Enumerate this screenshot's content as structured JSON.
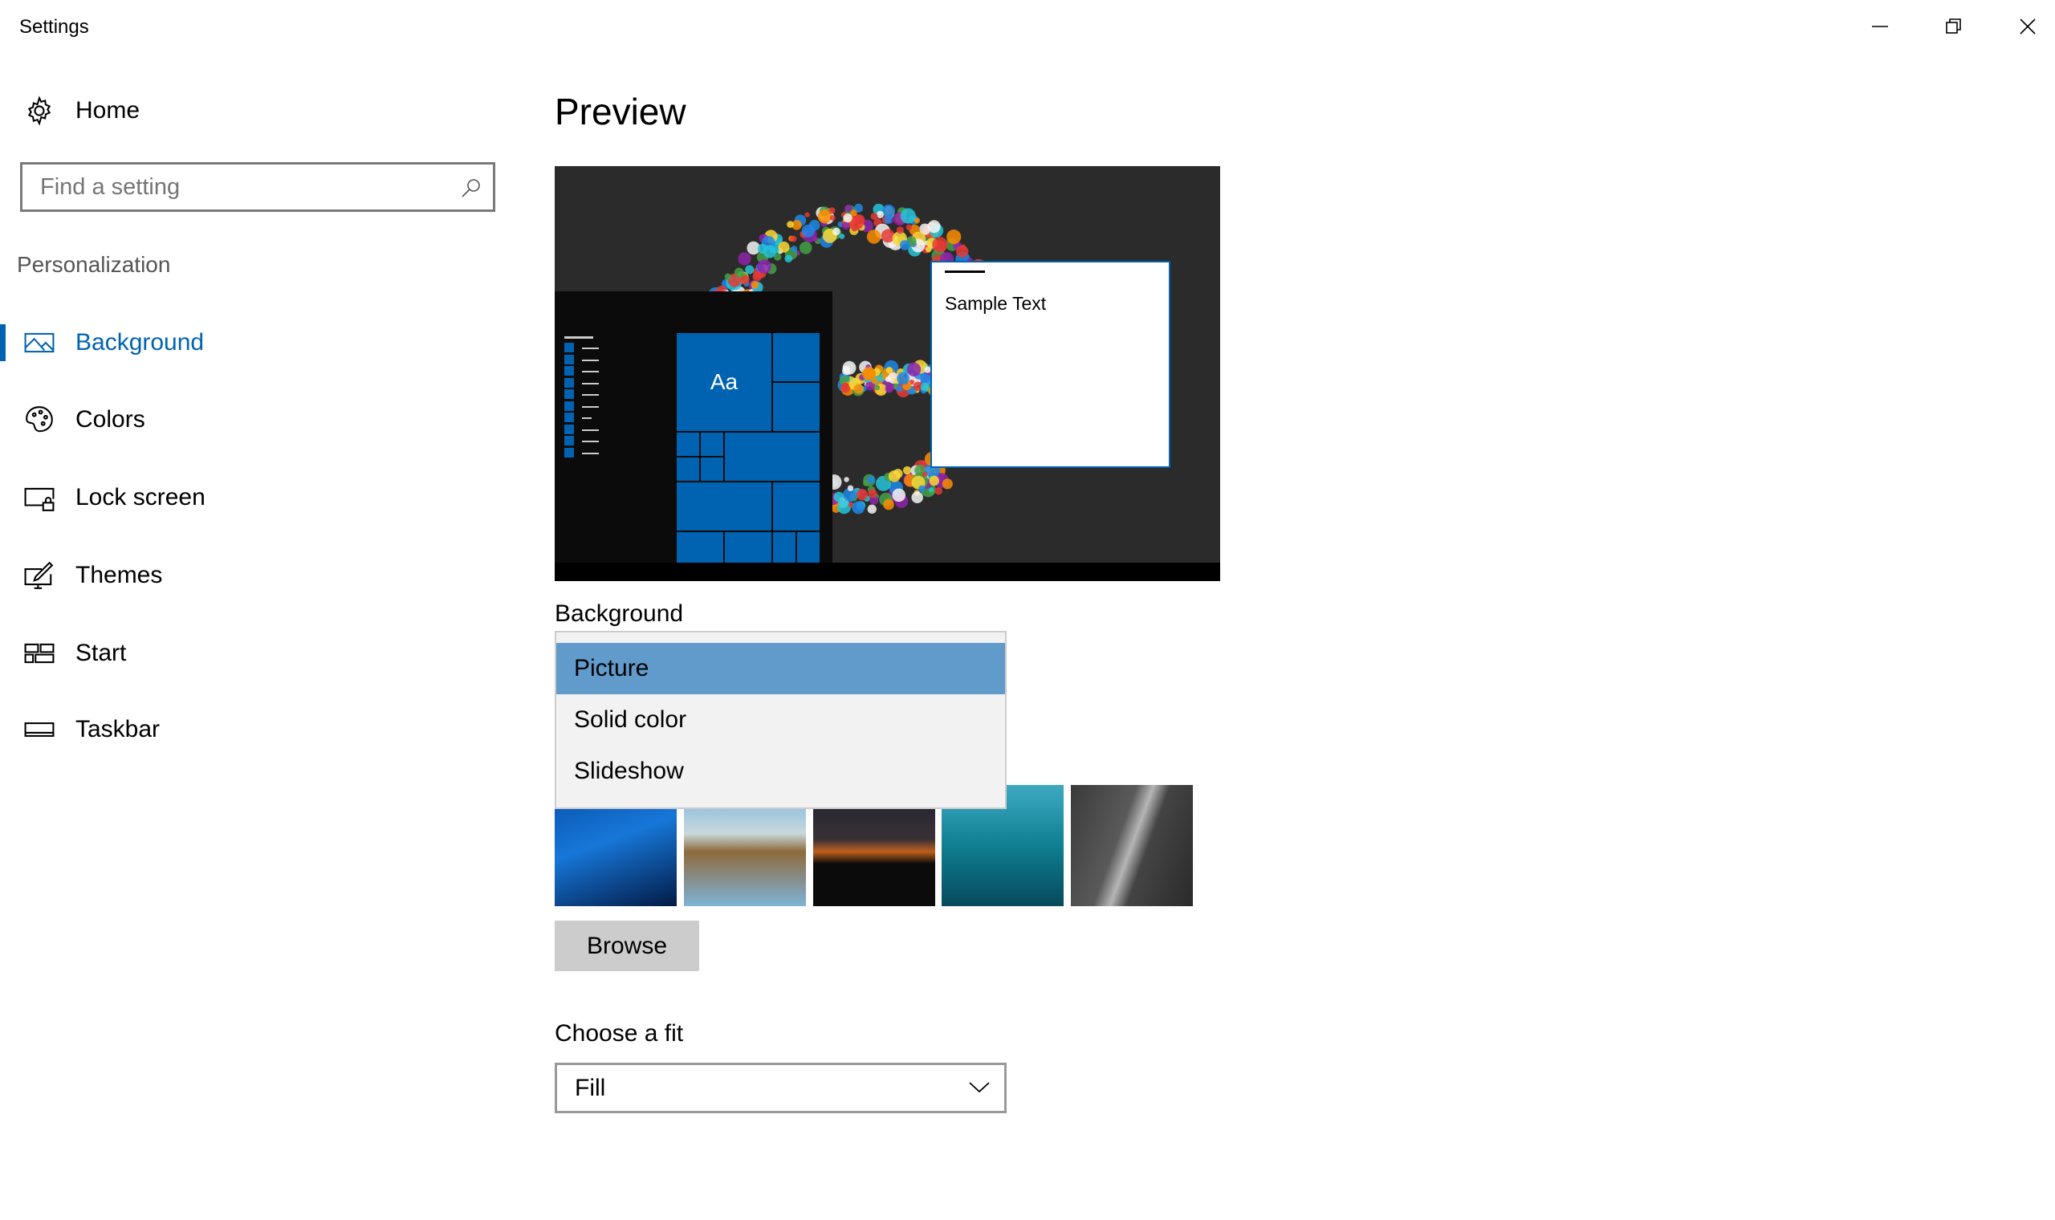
{
  "window": {
    "title": "Settings",
    "controls": [
      "minimize-icon",
      "restore-icon",
      "close-icon"
    ]
  },
  "sidebar": {
    "home": "Home",
    "search_placeholder": "Find a setting",
    "section": "Personalization",
    "items": [
      {
        "label": "Background",
        "icon": "picture-icon",
        "active": true
      },
      {
        "label": "Colors",
        "icon": "palette-icon"
      },
      {
        "label": "Lock screen",
        "icon": "lock-screen-icon"
      },
      {
        "label": "Themes",
        "icon": "themes-icon"
      },
      {
        "label": "Start",
        "icon": "start-icon"
      },
      {
        "label": "Taskbar",
        "icon": "taskbar-icon"
      }
    ]
  },
  "main": {
    "title": "Preview",
    "preview": {
      "tile_text": "Aa",
      "sample_text": "Sample Text"
    },
    "background_label": "Background",
    "background_options": [
      "Picture",
      "Solid color",
      "Slideshow"
    ],
    "background_selected": "Picture",
    "browse": "Browse",
    "fit_label": "Choose a fit",
    "fit_value": "Fill"
  },
  "colors": {
    "accent": "#0063b1",
    "highlight": "#619bcc"
  }
}
